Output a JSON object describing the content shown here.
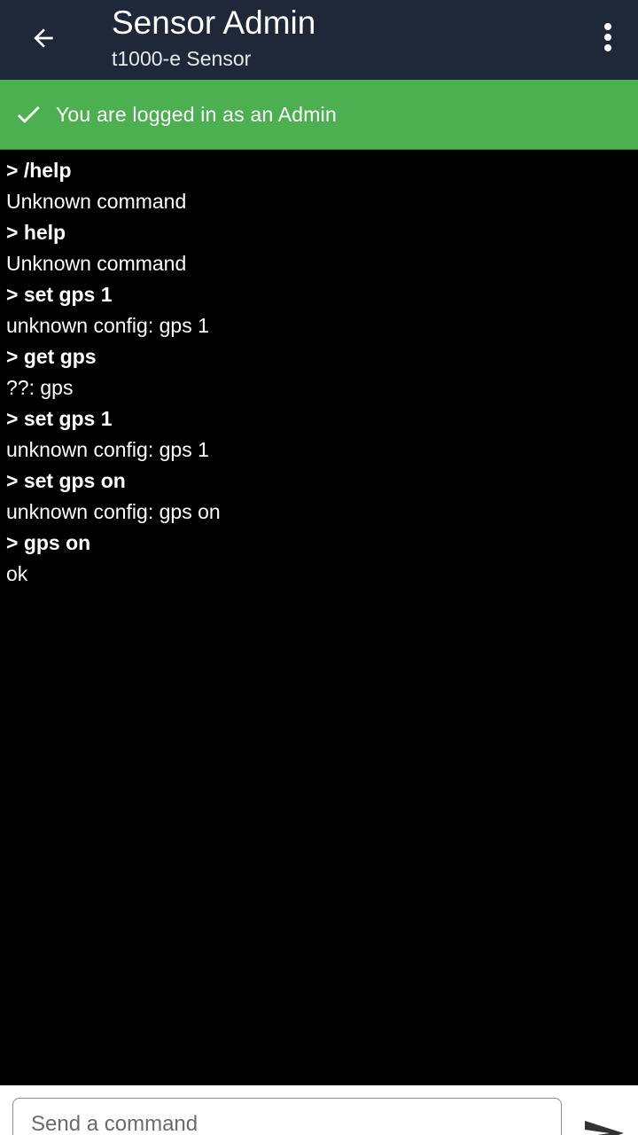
{
  "header": {
    "title": "Sensor Admin",
    "subtitle": "t1000-e Sensor",
    "back_icon": "arrow-left-icon",
    "menu_icon": "more-vertical-icon"
  },
  "banner": {
    "icon": "checkmark-icon",
    "text": "You are logged in as an Admin",
    "color": "#4caf50"
  },
  "console": {
    "lines": [
      {
        "type": "cmd",
        "text": "> /help"
      },
      {
        "type": "out",
        "text": "Unknown command"
      },
      {
        "type": "cmd",
        "text": "> help"
      },
      {
        "type": "out",
        "text": "Unknown command"
      },
      {
        "type": "cmd",
        "text": "> set gps 1"
      },
      {
        "type": "out",
        "text": "unknown config: gps 1"
      },
      {
        "type": "cmd",
        "text": "> get gps"
      },
      {
        "type": "out",
        "text": "??: gps"
      },
      {
        "type": "cmd",
        "text": "> set gps 1"
      },
      {
        "type": "out",
        "text": "unknown config: gps 1"
      },
      {
        "type": "cmd",
        "text": "> set gps on"
      },
      {
        "type": "out",
        "text": "unknown config: gps on"
      },
      {
        "type": "cmd",
        "text": "> gps on"
      },
      {
        "type": "out",
        "text": "ok"
      }
    ]
  },
  "input": {
    "placeholder": "Send a command",
    "value": "",
    "send_icon": "send-icon"
  },
  "colors": {
    "appbar": "#1f2838",
    "background": "#000000",
    "banner": "#4caf50"
  }
}
